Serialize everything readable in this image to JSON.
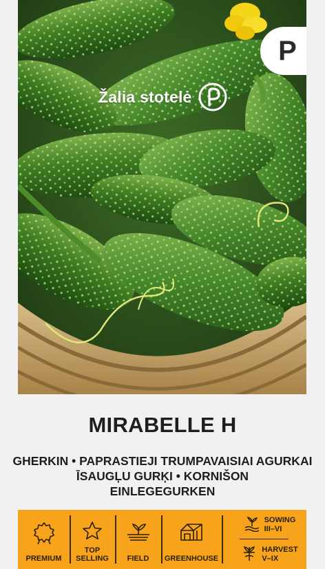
{
  "brand": {
    "name": "Žalia stotelė"
  },
  "badge": {
    "letter": "P"
  },
  "product": {
    "title": "MIRABELLE H",
    "subtitle_lines": [
      "GHERKIN • PAPRASTIEJI TRUMPAVAISIAI AGURKAI",
      "ĪSAUGĻU GURĶI • KORNIŠON",
      "EINLEGEGURKEN"
    ]
  },
  "features": [
    {
      "icon": "rosette-icon",
      "label_lines": [
        "PREMIUM"
      ]
    },
    {
      "icon": "star-icon",
      "label_lines": [
        "TOP",
        "SELLING"
      ]
    },
    {
      "icon": "field-sprout-icon",
      "label_lines": [
        "FIELD"
      ]
    },
    {
      "icon": "greenhouse-icon",
      "label_lines": [
        "GREENHOUSE"
      ]
    }
  ],
  "season": {
    "sowing": {
      "icon": "sowing-icon",
      "label": "SOWING",
      "months": "III–VI"
    },
    "harvest": {
      "icon": "harvest-icon",
      "label": "HARVEST",
      "months": "V–IX"
    }
  },
  "colors": {
    "feature_bar": "#f7a41c",
    "background": "#f1f1f1",
    "title_text": "#1e1e1e"
  }
}
